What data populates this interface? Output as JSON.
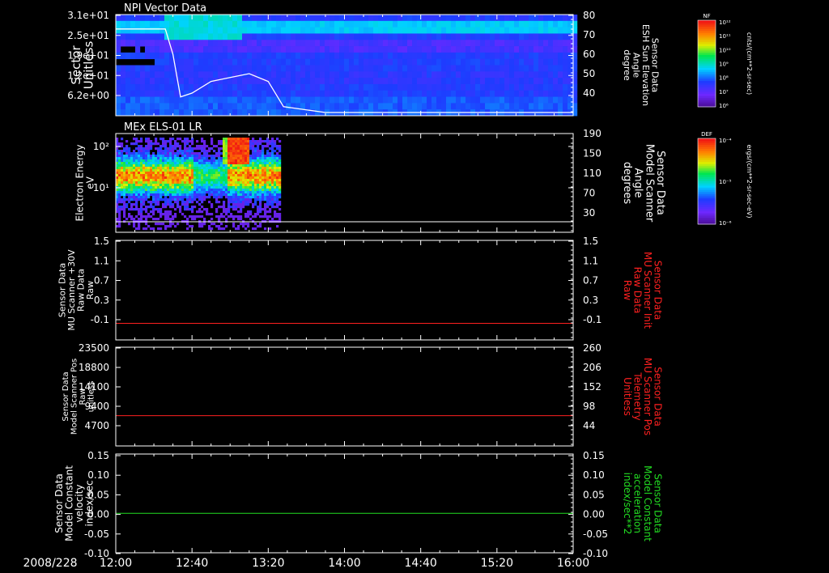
{
  "date_label": "2008/228",
  "time_ticks": [
    "12:00",
    "12:40",
    "13:20",
    "14:00",
    "14:40",
    "15:20",
    "16:00"
  ],
  "colors": {
    "background": "#000000",
    "axis": "#ffffff",
    "red_trace": "#ff2020",
    "green_trace": "#22dd22"
  },
  "panels": [
    {
      "title": "NPI Vector Data",
      "left_label": [
        "Sector",
        "Unitless"
      ],
      "left_ticks": [
        "3.1e+01",
        "2.5e+01",
        "1.9e+01",
        "1.2e+01",
        "6.2e+00"
      ],
      "right_label": [
        "Sensor Data",
        "ESH Sun Elevation",
        "Angle",
        "degree"
      ],
      "right_ticks": [
        "80",
        "70",
        "60",
        "50",
        "40"
      ],
      "colorbar": {
        "title": "NF",
        "unit": "cnts/(cm**2-sr-sec)",
        "tick_labels": [
          "10¹²",
          "10¹¹",
          "10¹⁰",
          "10⁹",
          "10⁸",
          "10⁷",
          "10⁶"
        ]
      }
    },
    {
      "title": "MEx ELS-01 LR",
      "left_label": [
        "Electron Energy",
        "eV"
      ],
      "left_ticks": [
        "10²",
        "10¹"
      ],
      "right_label": [
        "Sensor Data",
        "Model Scanner",
        "Angle",
        "degrees"
      ],
      "right_ticks": [
        "190",
        "150",
        "110",
        "70",
        "30"
      ],
      "colorbar": {
        "title": "DEF",
        "unit": "ergs/(cm**2-sr-sec-eV)",
        "tick_labels": [
          "10⁻⁴",
          "10⁻⁵",
          "10⁻⁶"
        ]
      }
    },
    {
      "title": "",
      "left_label": [
        "Sensor Data",
        "MU Scanner +30V",
        "Raw Data",
        "Raw"
      ],
      "left_ticks": [
        "1.5",
        "1.1",
        "0.7",
        "0.3",
        "-0.1"
      ],
      "right_label": [
        "Sensor Data",
        "MU Scanner Init",
        "Raw Data",
        "Raw"
      ],
      "right_ticks": [
        "1.5",
        "1.1",
        "0.7",
        "0.3",
        "-0.1"
      ]
    },
    {
      "title": "",
      "left_label": [
        "Sensor Data",
        "Model Scanner Pos",
        "Raw",
        "unitless"
      ],
      "left_ticks": [
        "23500",
        "18800",
        "14100",
        "9400",
        "4700"
      ],
      "right_label": [
        "Sensor Data",
        "MU Scanner Pos",
        "Telemetry",
        "Unitless"
      ],
      "right_ticks": [
        "260",
        "206",
        "152",
        "98",
        "44"
      ]
    },
    {
      "title": "",
      "left_label": [
        "Sensor Data",
        "Model Constant",
        "velocity",
        "index/sec"
      ],
      "left_ticks": [
        "0.15",
        "0.10",
        "0.05",
        "0.00",
        "-0.05",
        "-0.10"
      ],
      "right_label": [
        "Sensor Data",
        "Model Constant",
        "acceleration",
        "index/sec**2"
      ],
      "right_ticks": [
        "0.15",
        "0.10",
        "0.05",
        "0.00",
        "-0.05",
        "-0.10"
      ]
    }
  ],
  "chart_data": [
    {
      "type": "heatmap",
      "title": "NPI Vector Data",
      "xlabel": "",
      "ylabel": "Sector Unitless",
      "x_range": [
        "12:00",
        "16:00"
      ],
      "ylim": [
        0,
        31
      ],
      "data_end_time": "14:00",
      "overlay_series": {
        "name": "Sensor Data ESH Sun Elevation Angle",
        "axis": "right",
        "ylim": [
          30,
          80
        ],
        "x_min": [
          0,
          10,
          20,
          26,
          30,
          34,
          40,
          50,
          60,
          70,
          80,
          88,
          110,
          240
        ],
        "values": [
          73,
          73,
          73,
          73,
          60,
          38,
          40,
          46,
          48,
          50,
          46,
          33,
          30,
          30
        ]
      }
    },
    {
      "type": "heatmap",
      "title": "MEx ELS-01 LR",
      "ylabel": "Electron Energy eV",
      "y_scale": "log",
      "x_range": [
        "12:00",
        "16:00"
      ],
      "data_end_time": "13:45",
      "overlay_series": {
        "name": "Sensor Data Model Scanner Angle",
        "axis": "right",
        "ylim": [
          0,
          190
        ],
        "values_constant": 5
      }
    },
    {
      "type": "line",
      "ylabel": "Sensor Data MU Scanner +30V Raw Data Raw",
      "ylim": [
        -0.3,
        1.5
      ],
      "series": [
        {
          "name": "Sensor Data MU Scanner Init Raw Data Raw",
          "x": [
            "12:00",
            "16:00"
          ],
          "values": [
            0.0,
            0.0
          ]
        }
      ]
    },
    {
      "type": "line",
      "ylabel": "Sensor Data Model Scanner Pos Raw unitless",
      "ylim": [
        0,
        23500
      ],
      "series": [
        {
          "name": "Sensor Data MU Scanner Pos Telemetry Unitless",
          "x": [
            "12:00",
            "16:00"
          ],
          "values": [
            7200,
            7200
          ]
        }
      ]
    },
    {
      "type": "line",
      "ylabel": "Sensor Data Model Constant velocity index/sec",
      "ylim": [
        -0.1,
        0.15
      ],
      "series": [
        {
          "name": "Sensor Data Model Constant acceleration index/sec**2",
          "x": [
            "12:00",
            "16:00"
          ],
          "values": [
            0.0,
            0.0
          ]
        }
      ]
    }
  ]
}
